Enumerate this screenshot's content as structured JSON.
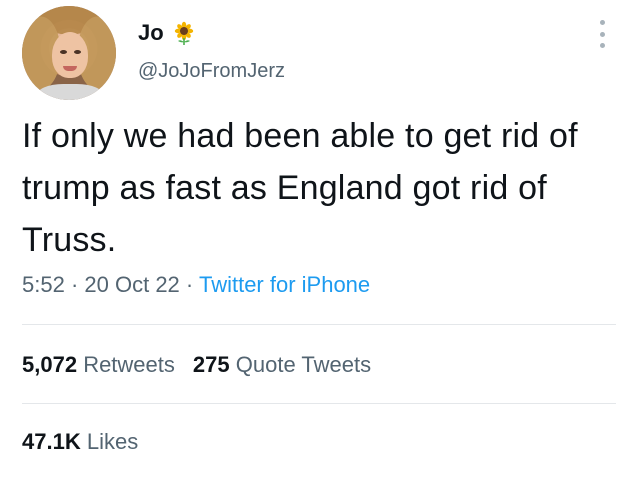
{
  "user": {
    "name": "Jo",
    "name_emoji": "sunflower",
    "handle": "@JoJoFromJerz"
  },
  "tweet": {
    "text": "If only we had been able to get rid of trump as fast as England got rid of Truss.",
    "time": "5:52",
    "date": "20 Oct 22",
    "separator": "·",
    "source": "Twitter for iPhone"
  },
  "stats": {
    "retweets_count": "5,072",
    "retweets_label": "Retweets",
    "quotes_count": "275",
    "quotes_label": "Quote Tweets",
    "likes_count": "47.1K",
    "likes_label": "Likes"
  },
  "colors": {
    "text": "#0f1419",
    "secondary": "#536471",
    "link": "#1d9bf0",
    "divider": "#e4e7ea"
  }
}
